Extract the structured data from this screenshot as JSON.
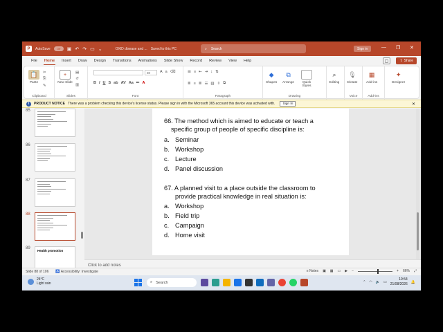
{
  "titlebar": {
    "autosave": "AutoSave",
    "toggle": "Off",
    "doc_title": "OXID disease and ...",
    "save_state": "Saved to this PC",
    "search_placeholder": "Search",
    "signin": "Sign in",
    "brand_color": "#b7472a"
  },
  "menu": {
    "items": [
      "File",
      "Home",
      "Insert",
      "Draw",
      "Design",
      "Transitions",
      "Animations",
      "Slide Show",
      "Record",
      "Review",
      "View",
      "Help"
    ],
    "active": "Home",
    "share": "Share"
  },
  "ribbon": {
    "groups": [
      "Clipboard",
      "Slides",
      "Font",
      "Paragraph",
      "Drawing",
      "Editing",
      "Voice",
      "Add-ins"
    ],
    "buttons": {
      "paste": "Paste",
      "new_slide": "New Slide",
      "shapes": "Shapes",
      "arrange": "Arrange",
      "quick_styles": "Quick Styles",
      "editing": "Editing",
      "dictate": "Dictate",
      "addins": "Add-ins",
      "designer": "Designer"
    },
    "font_size": "30"
  },
  "notice": {
    "title": "PRODUCT NOTICE",
    "message": "There was a problem checking this device's license status. Please sign in with the Microsoft 365 account this device was activated with.",
    "button": "Sign In"
  },
  "thumbnails": [
    {
      "num": "85"
    },
    {
      "num": "86"
    },
    {
      "num": "87"
    },
    {
      "num": "88",
      "selected": true
    },
    {
      "num": "89",
      "title": "Health promotion"
    }
  ],
  "slide": {
    "q66_line1": "66. The method which is aimed to educate or teach a",
    "q66_line2": "specific group of people of specific discipline is:",
    "q66_options": [
      {
        "letter": "a.",
        "text": "Seminar"
      },
      {
        "letter": "b.",
        "text": "Workshop"
      },
      {
        "letter": "c.",
        "text": "Lecture"
      },
      {
        "letter": "d.",
        "text": "Panel discussion"
      }
    ],
    "q67_line1": "67. A planned visit to a place outside the classroom to",
    "q67_line2": "provide practical knowledge in real situation is:",
    "q67_options": [
      {
        "letter": "a.",
        "text": "Workshop"
      },
      {
        "letter": "b.",
        "text": "Field trip"
      },
      {
        "letter": "c.",
        "text": "Campaign"
      },
      {
        "letter": "d.",
        "text": "Home visit"
      }
    ]
  },
  "notes_placeholder": "Click to add notes",
  "status": {
    "slide_pos": "Slide 88 of 106",
    "accessibility": "Accessibility: Investigate",
    "notes": "Notes",
    "zoom": "66%"
  },
  "taskbar": {
    "temp": "24°C",
    "weather": "Light rain",
    "search": "Search",
    "time": "19:54",
    "date": "21/08/2026"
  }
}
